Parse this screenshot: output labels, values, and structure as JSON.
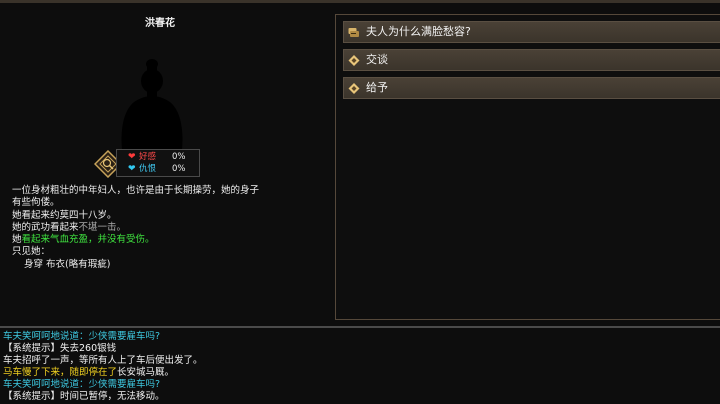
{
  "character": {
    "name": "洪春花",
    "relations": [
      {
        "label": "好感",
        "value": "0%",
        "color": "#ff3b3b"
      },
      {
        "label": "仇恨",
        "value": "0%",
        "color": "#32c8f0"
      }
    ],
    "description": {
      "line1": "一位身材粗壮的中年妇人，也许是由于长期操劳，她的身子",
      "line2": "有些佝偻。",
      "age_line": "她看起来约莫四十八岁。",
      "skill_prefix": "她的武功看起来",
      "skill_value": "不堪一击。",
      "health_prefix": "她",
      "health_value": "看起来气血充盈，并没有受伤。",
      "seen_label": "只见她：",
      "wearing_label": "身穿",
      "wearing_value": "布衣(略有瑕疵)"
    }
  },
  "options": [
    {
      "label": "夫人为什么满脸愁容?",
      "icon": "chat-icon"
    },
    {
      "label": "交谈",
      "icon": "diamond-icon"
    },
    {
      "label": "给予",
      "icon": "diamond-icon"
    }
  ],
  "log": [
    {
      "text": "车夫笑呵呵地说道：少侠需要雇车吗?",
      "color": "cyan"
    },
    {
      "text": "【系统提示】失去260银钱",
      "color": "white"
    },
    {
      "text": "车夫招呼了一声，等所有人上了车后便出发了。",
      "color": "white"
    },
    {
      "text_a": "马车慢了下来，随即停在了",
      "text_b": "长安城马厩。",
      "color": "yellow"
    },
    {
      "text": "车夫笑呵呵地说道：少侠需要雇车吗?",
      "color": "cyan"
    },
    {
      "text": "【系统提示】时间已暂停，无法移动。",
      "color": "white"
    }
  ]
}
